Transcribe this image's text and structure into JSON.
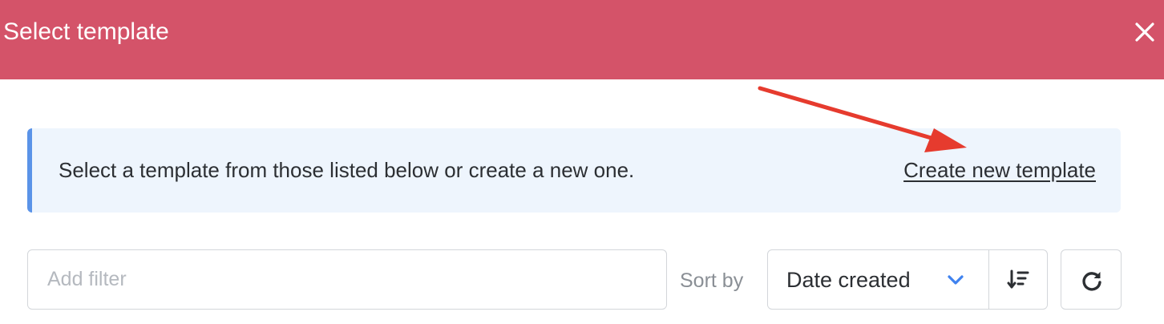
{
  "header": {
    "title": "Select template",
    "background_color": "#d45369",
    "close_icon": "close-icon"
  },
  "banner": {
    "message": "Select a template from those listed below or create a new one.",
    "link_label": "Create new template",
    "accent_color": "#5a93e8",
    "background_color": "#eef5fd"
  },
  "filter": {
    "placeholder": "Add filter",
    "value": ""
  },
  "sort": {
    "label": "Sort by",
    "selected": "Date created",
    "dropdown_icon": "chevron-down-icon",
    "order_icon": "sort-descending-icon"
  },
  "refresh": {
    "icon": "refresh-icon"
  },
  "annotation": {
    "type": "red-arrow",
    "color": "#e63b2e",
    "points_to": "Create new template"
  }
}
